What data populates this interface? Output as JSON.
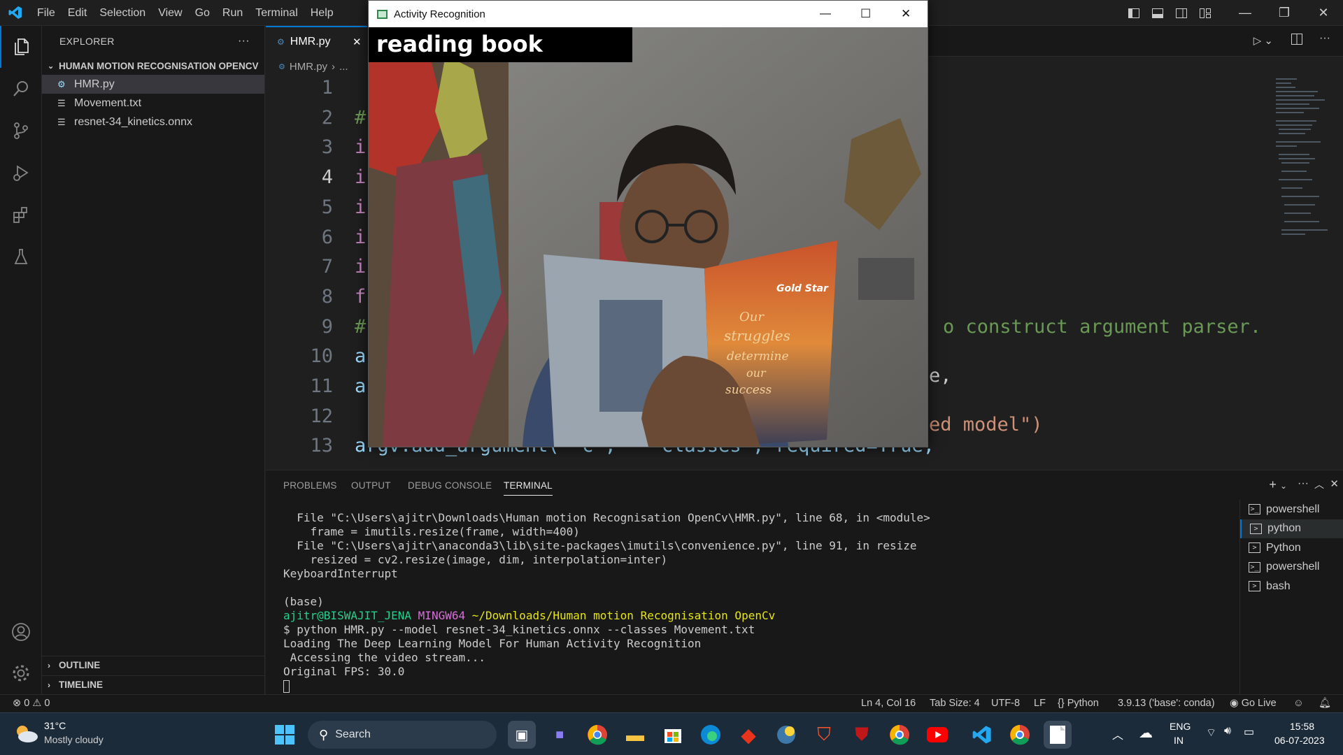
{
  "titlebar": {
    "menu": [
      "File",
      "Edit",
      "Selection",
      "View",
      "Go",
      "Run",
      "Terminal",
      "Help"
    ]
  },
  "sidebar": {
    "title": "EXPLORER",
    "more": "···",
    "folder": "HUMAN MOTION RECOGNISATION OPENCV",
    "files": [
      {
        "name": "HMR.py",
        "icon": "python-file-icon"
      },
      {
        "name": "Movement.txt",
        "icon": "text-file-icon"
      },
      {
        "name": "resnet-34_kinetics.onnx",
        "icon": "text-file-icon"
      }
    ],
    "outline": "OUTLINE",
    "timeline": "TIMELINE"
  },
  "editor": {
    "tab": "HMR.py",
    "breadcrumb": "HMR.py",
    "breadcrumb_more": "...",
    "lines": [
      {
        "n": "1",
        "text": ""
      },
      {
        "n": "2",
        "text": "#"
      },
      {
        "n": "3",
        "text": "i"
      },
      {
        "n": "4",
        "text": "i"
      },
      {
        "n": "5",
        "text": "i"
      },
      {
        "n": "6",
        "text": "i"
      },
      {
        "n": "7",
        "text": "i"
      },
      {
        "n": "8",
        "text": "f"
      },
      {
        "n": "9",
        "text": "#"
      },
      {
        "n": "10",
        "text": "a"
      },
      {
        "n": "11",
        "text": "a"
      },
      {
        "n": "12",
        "text": ""
      },
      {
        "n": "13",
        "text": "argv.add_argument(\"-c\", \"--classes\", required=True,"
      }
    ],
    "visible_right_9": "o construct argument parser.",
    "visible_right_11": "e,",
    "visible_right_12": "ed model\")"
  },
  "overlay": {
    "title": "Activity Recognition",
    "label": "reading book",
    "book_brand": "Gold Star",
    "book_text": [
      "Our",
      "struggles",
      "determine",
      "our",
      "success"
    ]
  },
  "panel": {
    "tabs": [
      "PROBLEMS",
      "OUTPUT",
      "DEBUG CONSOLE",
      "TERMINAL"
    ],
    "terminal": {
      "l1": "  File \"C:\\Users\\ajitr\\Downloads\\Human motion Recognisation OpenCv\\HMR.py\", line 68, in <module>",
      "l2": "    frame = imutils.resize(frame, width=400)",
      "l3": "  File \"C:\\Users\\ajitr\\anaconda3\\lib\\site-packages\\imutils\\convenience.py\", line 91, in resize",
      "l4": "    resized = cv2.resize(image, dim, interpolation=inter)",
      "l5": "KeyboardInterrupt",
      "l6": "",
      "l7": "(base)",
      "user": "ajitr@BISWAJIT_JENA",
      "shell": "MINGW64",
      "path": "~/Downloads/Human motion Recognisation OpenCv",
      "l9": "$ python HMR.py --model resnet-34_kinetics.onnx --classes Movement.txt",
      "l10": "Loading The Deep Learning Model For Human Activity Recognition",
      "l11": " Accessing the video stream...",
      "l12": "Original FPS: 30.0"
    },
    "terminals": [
      "powershell",
      "python",
      "Python",
      "powershell",
      "bash"
    ]
  },
  "status": {
    "errors": "0",
    "warnings": "0",
    "position": "Ln 4, Col 16",
    "tabsize": "Tab Size: 4",
    "encoding": "UTF-8",
    "eol": "LF",
    "language": "Python",
    "interpreter": "3.9.13 ('base': conda)",
    "golive": "Go Live"
  },
  "taskbar": {
    "temp": "31°C",
    "weather": "Mostly cloudy",
    "search": "Search",
    "lang1": "ENG",
    "lang2": "IN",
    "time": "15:58",
    "date": "06-07-2023"
  },
  "colors": {
    "accent": "#0078d4",
    "editor_bg": "#1f1f1f",
    "taskbar_bg": "#1c2b3a"
  }
}
